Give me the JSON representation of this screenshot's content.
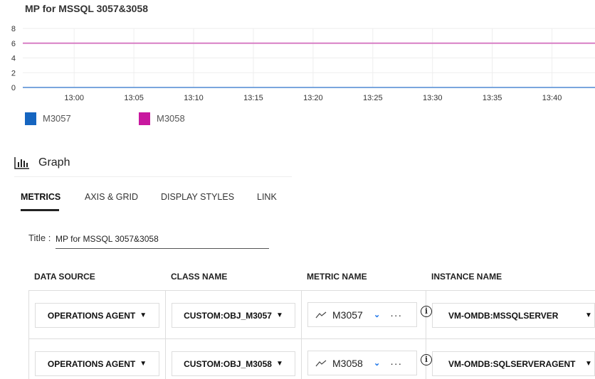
{
  "chart_data": {
    "type": "line",
    "title": "MP for MSSQL 3057&3058",
    "x_ticks": [
      "13:00",
      "13:05",
      "13:10",
      "13:15",
      "13:20",
      "13:25",
      "13:30",
      "13:35",
      "13:40"
    ],
    "xlim": [
      "12:55.7",
      "13:43.6"
    ],
    "y_ticks": [
      "0",
      "2",
      "4",
      "6",
      "8"
    ],
    "ylim": [
      0,
      8
    ],
    "grid": true,
    "legend_position": "bottom-left",
    "series": [
      {
        "name": "M3057",
        "color": "#1565c0",
        "line_color": "#7aa6dd",
        "value": 0
      },
      {
        "name": "M3058",
        "color": "#c8189f",
        "line_color": "#d77fc5",
        "value": 6
      }
    ]
  },
  "graph": {
    "heading": "Graph",
    "icon": "bar-chart-icon"
  },
  "tabs": [
    "METRICS",
    "AXIS & GRID",
    "DISPLAY STYLES",
    "LINK"
  ],
  "active_tab": "METRICS",
  "form": {
    "title_label": "Title :",
    "title_value": "MP for MSSQL 3057&3058"
  },
  "columns": [
    "DATA SOURCE",
    "CLASS NAME",
    "METRIC NAME",
    "INSTANCE NAME"
  ],
  "rows": [
    {
      "data_source": "OPERATIONS AGENT",
      "class_name": "CUSTOM:OBJ_M3057",
      "metric": "M3057",
      "instance": "VM-OMDB:MSSQLSERVER"
    },
    {
      "data_source": "OPERATIONS AGENT",
      "class_name": "CUSTOM:OBJ_M3058",
      "metric": "M3058",
      "instance": "VM-OMDB:SQLSERVERAGENT"
    }
  ],
  "colors": {
    "accent": "#1a73e8"
  }
}
